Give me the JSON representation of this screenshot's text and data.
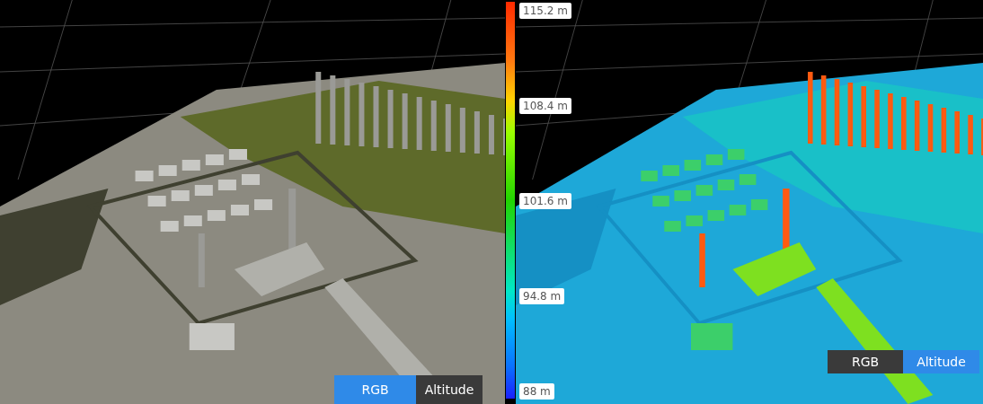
{
  "panels": [
    {
      "kind": "rgb",
      "toggle": [
        {
          "label": "RGB",
          "selected": true
        },
        {
          "label": "Altitude",
          "selected": false
        }
      ]
    },
    {
      "kind": "altitude",
      "toggle": [
        {
          "label": "RGB",
          "selected": false
        },
        {
          "label": "Altitude",
          "selected": true
        }
      ]
    }
  ],
  "legend": {
    "ticks": [
      "115.2 m",
      "108.4 m",
      "101.6 m",
      "94.8 m",
      "88 m"
    ]
  }
}
